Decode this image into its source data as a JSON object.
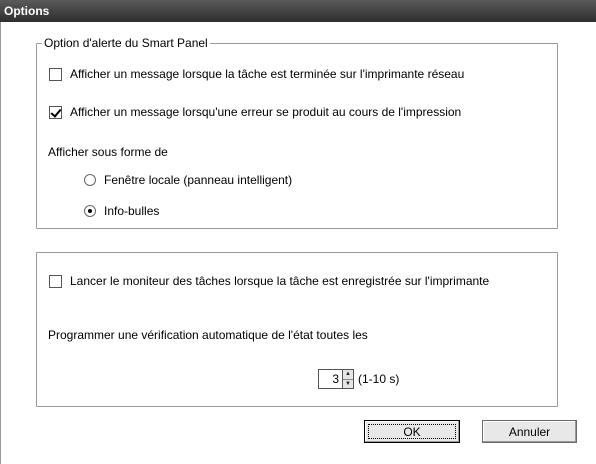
{
  "window": {
    "title": "Options"
  },
  "alert_group": {
    "legend": "Option d'alerte du Smart Panel",
    "network_message": {
      "label": "Afficher un message lorsque la tâche est terminée sur l'imprimante réseau",
      "checked": false
    },
    "error_message": {
      "label": "Afficher un message lorsqu'une erreur se produit au cours de l'impression",
      "checked": true
    },
    "display_as_label": "Afficher sous forme de",
    "display_options": [
      {
        "label": "Fenêtre locale (panneau intelligent)",
        "selected": false
      },
      {
        "label": "Info-bulles",
        "selected": true
      }
    ]
  },
  "monitor_group": {
    "launch_monitor": {
      "label": "Lancer le moniteur des tâches lorsque la tâche est enregistrée sur l'imprimante",
      "checked": false
    },
    "schedule_label": "Programmer une vérification automatique de l'état toutes les",
    "interval": {
      "value": "3",
      "range_label": "(1-10 s)"
    }
  },
  "buttons": {
    "ok_label": "OK",
    "cancel_label": "Annuler"
  },
  "icons": {
    "spin_up": "▲",
    "spin_down": "▼"
  }
}
